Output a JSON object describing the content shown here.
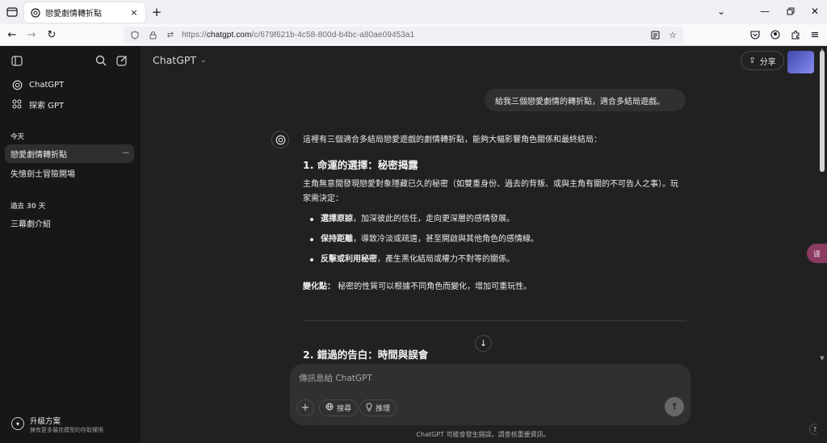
{
  "browser": {
    "tab_title": "戀愛劇情轉折點",
    "tab_close": "×",
    "new_tab": "+",
    "url_prefix": "https://",
    "url_host": "chatgpt.com",
    "url_path": "/c/679f621b-4c58-800d-b4bc-a80ae09453a1"
  },
  "sidebar": {
    "nav": [
      {
        "label": "ChatGPT",
        "icon": "chatgpt-logo-icon"
      },
      {
        "label": "探索 GPT",
        "icon": "grid-icon"
      }
    ],
    "today_label": "今天",
    "today_items": [
      "戀愛劇情轉折點",
      "失憶劍士冒險開場"
    ],
    "past_label": "過去 30 天",
    "past_items": [
      "三幕劇介紹"
    ],
    "upgrade_title": "升級方案",
    "upgrade_subtitle": "擁有更多最佳模型的存取權限"
  },
  "header": {
    "model": "ChatGPT",
    "share": "分享"
  },
  "conversation": {
    "user_message": "給我三個戀愛劇情的轉折點，適合多結局遊戲。",
    "intro": "這裡有三個適合多結局戀愛遊戲的劇情轉折點，能夠大幅影響角色關係和最終結局：",
    "section1_title": "1. 命運的選擇：秘密揭露",
    "section1_body": "主角無意間發現戀愛對象隱藏已久的秘密（如雙重身份、過去的背叛、或與主角有關的不可告人之事）。玩家需決定：",
    "bullets": [
      {
        "bold": "選擇原諒",
        "rest": "，加深彼此的信任，走向更深層的感情發展。"
      },
      {
        "bold": "保持距離",
        "rest": "，導致冷淡或疏遠，甚至開啟與其他角色的感情線。"
      },
      {
        "bold": "反擊或利用秘密",
        "rest": "，產生黑化結局或權力不對等的關係。"
      }
    ],
    "change_label": "變化點：",
    "change_text": "秘密的性質可以根據不同角色而變化，增加可重玩性。",
    "section2_title": "2. 錯過的告白：時間與誤會"
  },
  "composer": {
    "placeholder": "傳訊息給 ChatGPT",
    "search": "搜尋",
    "reason": "推理"
  },
  "footer": {
    "disclaimer": "ChatGPT 可能會發生錯誤。請查核重要資訊。",
    "help": "?"
  },
  "extension_badge": "译"
}
